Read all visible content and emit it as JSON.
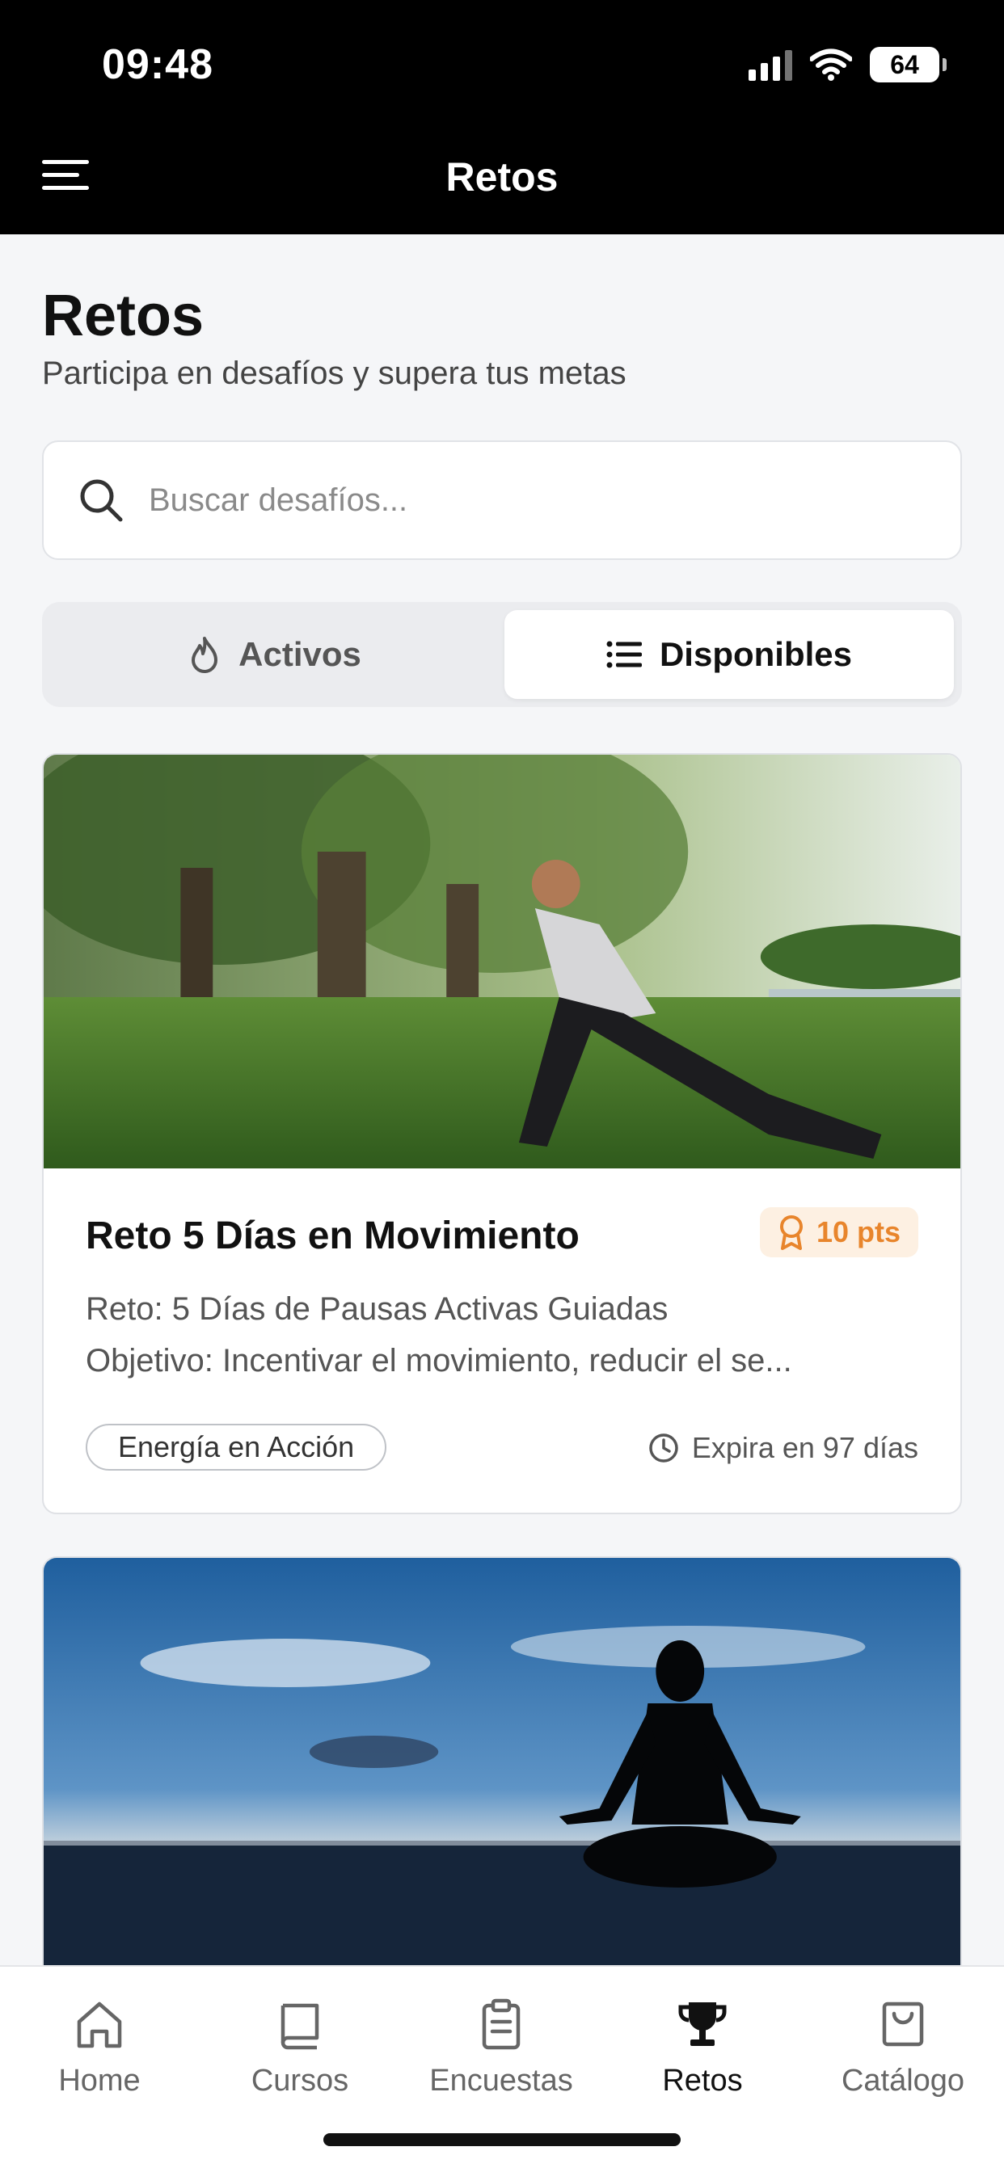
{
  "status_bar": {
    "time": "09:48",
    "battery": "64"
  },
  "header": {
    "title": "Retos",
    "menu_icon": "hamburger-menu-icon"
  },
  "page": {
    "title": "Retos",
    "subtitle": "Participa en desafíos y supera tus metas"
  },
  "search": {
    "placeholder": "Buscar desafíos...",
    "value": "",
    "icon": "search-icon"
  },
  "segments": [
    {
      "label": "Activos",
      "icon": "flame-icon",
      "active": false
    },
    {
      "label": "Disponibles",
      "icon": "list-icon",
      "active": true
    }
  ],
  "cards": [
    {
      "image": "photo of woman stretching in park",
      "title": "Reto 5 Días en Movimiento",
      "points": "10 pts",
      "points_icon": "award-icon",
      "desc_line1": "Reto: 5 Días de Pausas Activas Guiadas",
      "desc_line2": "Objetivo: Incentivar el movimiento, reducir el se...",
      "tag": "Energía en Acción",
      "expiry": "Expira en 97 días",
      "expiry_icon": "clock-icon"
    },
    {
      "image": "silhouette of person meditating by the sea"
    }
  ],
  "tabbar": [
    {
      "label": "Home",
      "icon": "home-icon",
      "active": false
    },
    {
      "label": "Cursos",
      "icon": "book-icon",
      "active": false
    },
    {
      "label": "Encuestas",
      "icon": "clipboard-icon",
      "active": false
    },
    {
      "label": "Retos",
      "icon": "trophy-icon",
      "active": true
    },
    {
      "label": "Catálogo",
      "icon": "shopping-bag-icon",
      "active": false
    }
  ],
  "colors": {
    "accent_orange": "#e8852c",
    "badge_bg": "#fdf0e2",
    "header_bg": "#000000"
  }
}
